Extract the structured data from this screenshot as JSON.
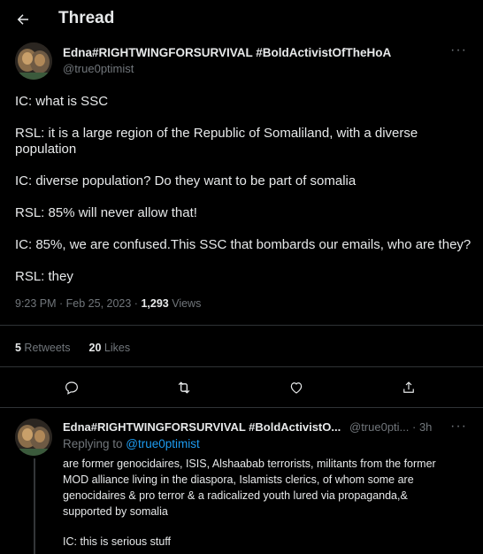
{
  "header": {
    "title": "Thread"
  },
  "icons": {
    "back": "arrow-left-icon",
    "reply": "comment-icon",
    "retweet": "retweet-icon",
    "like": "heart-icon",
    "share": "share-icon",
    "more": "more-horizontal-icon"
  },
  "colors": {
    "background": "#000000",
    "text": "#e7e9ea",
    "muted": "#71767b",
    "link": "#1d9bf0",
    "divider": "#2f3336"
  },
  "tweet": {
    "author_name": "Edna#RIGHTWINGFORSURVIVAL #BoldActivistOfTheHoA",
    "author_handle": "@true0ptimist",
    "more": "···",
    "lines": [
      "IC: what is SSC",
      "RSL: it is a large region of the Republic of Somaliland, with a diverse",
      "population",
      "IC: diverse population? Do they want to be part of somalia",
      "RSL: 85% will never allow that!",
      "IC: 85%, we are confused.This SSC that bombards our emails, who are they?",
      "RSL: they"
    ],
    "time": "9:23 PM · Feb 25, 2023 · ",
    "views_count": "1,293",
    "views_label": " Views",
    "retweets_count": "5",
    "retweets_label": " Retweets",
    "likes_count": "20",
    "likes_label": " Likes"
  },
  "reply": {
    "author_name": "Edna#RIGHTWINGFORSURVIVAL #BoldActivistO...",
    "meta": "@true0pti... · 3h",
    "more": "···",
    "replying_label": "Replying to ",
    "replying_handle": "@true0ptimist",
    "lines": [
      "are former genocidaires, ISIS, Alshaabab terrorists, militants from the former",
      "MOD alliance living in the diaspora, Islamists clerics, of whom some are",
      "genocidaires & pro terror & a radicalized youth lured via propaganda,&",
      "supported by somalia",
      "",
      "IC: this is serious stuff"
    ]
  }
}
